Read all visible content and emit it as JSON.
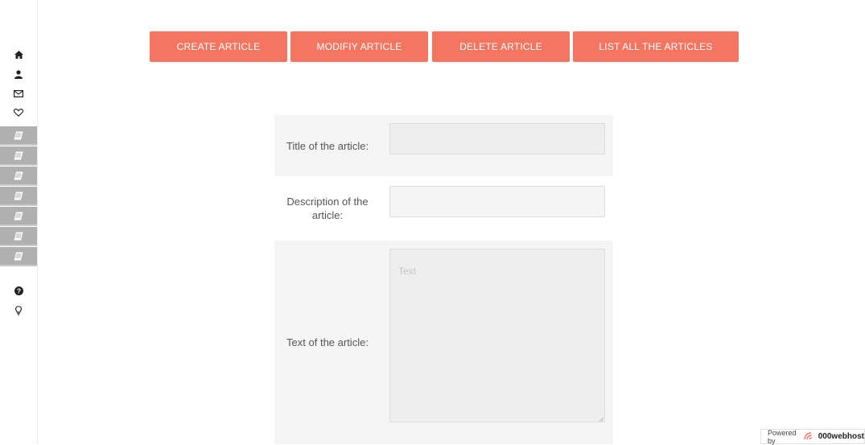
{
  "sidebar": {
    "items": [
      {
        "icon": "home-icon"
      },
      {
        "icon": "user-icon"
      },
      {
        "icon": "envelope-icon"
      },
      {
        "icon": "heart-icon"
      },
      {
        "icon": "article-icon"
      },
      {
        "icon": "article-icon"
      },
      {
        "icon": "article-icon"
      },
      {
        "icon": "article-icon"
      },
      {
        "icon": "article-icon"
      },
      {
        "icon": "article-icon"
      },
      {
        "icon": "article-icon"
      },
      {
        "icon": "question-circle-icon"
      },
      {
        "icon": "lightbulb-icon"
      }
    ]
  },
  "toolbar": {
    "create_label": "CREATE ARTICLE",
    "modify_label": "MODIFIY ARTICLE",
    "delete_label": "DELETE ARTICLE",
    "list_label": "LIST ALL THE ARTICLES",
    "accent_color": "#f47560"
  },
  "form": {
    "title_label": "Title of the article:",
    "title_value": "",
    "description_label": "Description of the article:",
    "description_value": "",
    "text_label": "Text of the article:",
    "text_placeholder": "Text"
  },
  "footer": {
    "powered_by": "Powered by",
    "brand": "000webhost"
  }
}
